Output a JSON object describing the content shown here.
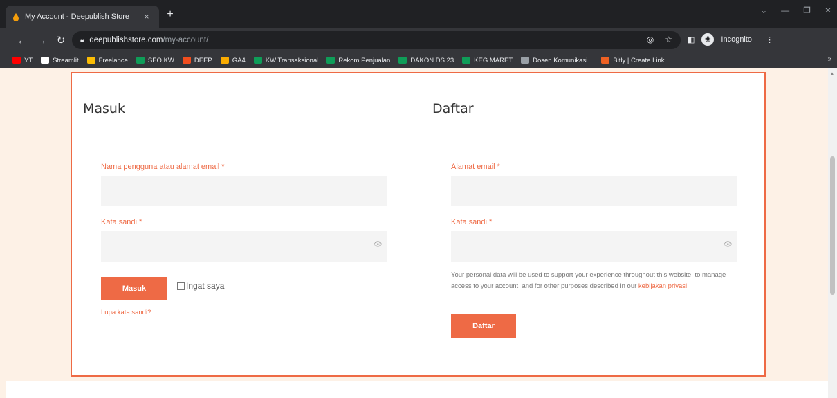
{
  "browser": {
    "tab_title": "My Account - Deepublish Store",
    "tab_close": "×",
    "new_tab": "+",
    "url_host": "deepublishstore.com",
    "url_path": "/my-account/",
    "incognito_label": "Incognito",
    "bookmarks": [
      {
        "label": "YT",
        "color": "#ff0000"
      },
      {
        "label": "Streamlit",
        "color": "#ffffff"
      },
      {
        "label": "Freelance",
        "color": "#fbbc04"
      },
      {
        "label": "SEO KW",
        "color": "#0f9d58"
      },
      {
        "label": "DEEP",
        "color": "#f24e1e"
      },
      {
        "label": "GA4",
        "color": "#f9ab00"
      },
      {
        "label": "KW Transaksional",
        "color": "#0f9d58"
      },
      {
        "label": "Rekom Penjualan",
        "color": "#0f9d58"
      },
      {
        "label": "DAKON DS 23",
        "color": "#0f9d58"
      },
      {
        "label": "KEG MARET",
        "color": "#0f9d58"
      },
      {
        "label": "Dosen Komunikasi...",
        "color": "#9aa0a6"
      },
      {
        "label": "Bitly | Create Link",
        "color": "#ee6123"
      }
    ],
    "bookmarks_more": "»"
  },
  "login": {
    "title": "Masuk",
    "username_label": "Nama pengguna atau alamat email *",
    "password_label": "Kata sandi *",
    "submit_label": "Masuk",
    "remember_label": "Ingat saya",
    "forgot_link": "Lupa kata sandi?"
  },
  "register": {
    "title": "Daftar",
    "email_label": "Alamat email *",
    "password_label": "Kata sandi *",
    "privacy_text": "Your personal data will be used to support your experience throughout this website, to manage access to your account, and for other purposes described in our ",
    "privacy_link": "kebijakan privasi",
    "privacy_end": ".",
    "submit_label": "Daftar"
  },
  "colors": {
    "accent": "#ee6a45",
    "page_bg": "#fdf1e6"
  }
}
